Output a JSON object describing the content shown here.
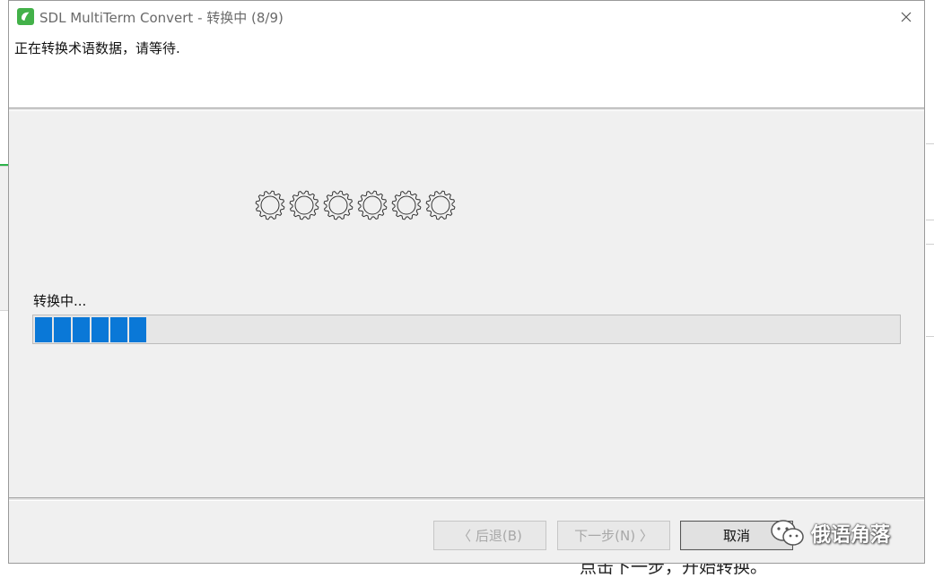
{
  "window": {
    "title": "SDL MultiTerm Convert - 转换中 (8/9)",
    "close_glyph": "✕",
    "app_icon": "multiterm-app-icon"
  },
  "header": {
    "description": "正在转换术语数据，请等待."
  },
  "main": {
    "gear_count": 6,
    "gear_icon": "gear-icon",
    "status_text": "转换中...",
    "progress": {
      "filled_segments": 6,
      "accent_color": "#0a78d7"
    }
  },
  "buttons": {
    "back_label": "〈 后退(B)",
    "next_label": "下一步(N) 〉",
    "cancel_label": "取消"
  },
  "watermark": {
    "text": "俄语角落",
    "icon": "wechat-icon"
  },
  "background": {
    "bottom_text": "点击下一步，开始转换。"
  }
}
